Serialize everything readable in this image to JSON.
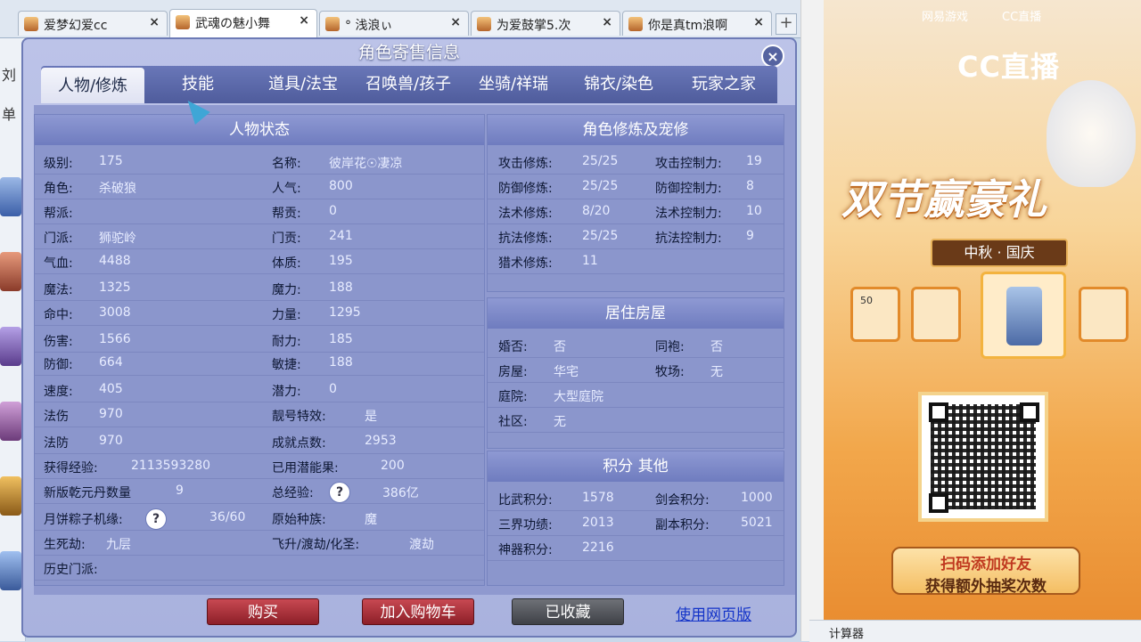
{
  "browser": {
    "tabs": [
      {
        "title": "爱梦幻爱cc",
        "close": "×"
      },
      {
        "title": "武魂の魅小舞",
        "close": "×"
      },
      {
        "title": "°  浅浪ぃ",
        "close": "×"
      },
      {
        "title": "为爱鼓掌5.次",
        "close": "×"
      },
      {
        "title": "你是真tm浪啊",
        "close": "×"
      }
    ],
    "new_tab": "+",
    "left_fragments": [
      "刘",
      "单"
    ]
  },
  "dialog": {
    "title": "角色寄售信息",
    "close": "×",
    "tabs": [
      "人物/修炼",
      "技能",
      "道具/法宝",
      "召唤兽/孩子",
      "坐骑/祥瑞",
      "锦衣/染色",
      "玩家之家"
    ],
    "active_tab": 0
  },
  "char_status": {
    "header": "人物状态",
    "left": [
      {
        "label": "级别:",
        "value": "175"
      },
      {
        "label": "角色:",
        "value": "杀破狼"
      },
      {
        "label": "帮派:",
        "value": ""
      },
      {
        "label": "门派:",
        "value": "狮驼岭"
      },
      {
        "label": "气血:",
        "value": "4488"
      },
      {
        "label": "魔法:",
        "value": "1325"
      },
      {
        "label": "命中:",
        "value": "3008"
      },
      {
        "label": "伤害:",
        "value": "1566"
      },
      {
        "label": "防御:",
        "value": "664"
      },
      {
        "label": "速度:",
        "value": "405"
      },
      {
        "label": "法伤",
        "value": "970"
      },
      {
        "label": "法防",
        "value": "970"
      },
      {
        "label": "获得经验:",
        "value": "2113593280"
      },
      {
        "label": "新版乾元丹数量",
        "value": "9"
      },
      {
        "label": "月饼粽子机缘:",
        "value": "36/60"
      },
      {
        "label": "生死劫:",
        "value": "九层"
      },
      {
        "label": "历史门派:",
        "value": ""
      }
    ],
    "right": [
      {
        "label": "名称:",
        "value": "彼岸花☉凄凉"
      },
      {
        "label": "人气:",
        "value": "800"
      },
      {
        "label": "帮贡:",
        "value": "0"
      },
      {
        "label": "门贡:",
        "value": "241"
      },
      {
        "label": "体质:",
        "value": "195"
      },
      {
        "label": "魔力:",
        "value": "188"
      },
      {
        "label": "力量:",
        "value": "1295"
      },
      {
        "label": "耐力:",
        "value": "185"
      },
      {
        "label": "敏捷:",
        "value": "188"
      },
      {
        "label": "潜力:",
        "value": "0"
      },
      {
        "label": "靓号特效:",
        "value": "是"
      },
      {
        "label": "成就点数:",
        "value": "2953"
      },
      {
        "label": "已用潜能果:",
        "value": "200"
      },
      {
        "label": "总经验:",
        "value": "386亿"
      },
      {
        "label": "原始种族:",
        "value": "魔"
      },
      {
        "label": "飞升/渡劫/化圣:",
        "value": "渡劫"
      }
    ],
    "help": "?"
  },
  "cultivation": {
    "header": "角色修炼及宠修",
    "left": [
      {
        "label": "攻击修炼:",
        "value": "25/25"
      },
      {
        "label": "防御修炼:",
        "value": "25/25"
      },
      {
        "label": "法术修炼:",
        "value": "8/20"
      },
      {
        "label": "抗法修炼:",
        "value": "25/25"
      },
      {
        "label": "猎术修炼:",
        "value": "11"
      }
    ],
    "right": [
      {
        "label": "攻击控制力:",
        "value": "19"
      },
      {
        "label": "防御控制力:",
        "value": "8"
      },
      {
        "label": "法术控制力:",
        "value": "10"
      },
      {
        "label": "抗法控制力:",
        "value": "9"
      }
    ]
  },
  "house": {
    "header": "居住房屋",
    "left": [
      {
        "label": "婚否:",
        "value": "否"
      },
      {
        "label": "房屋:",
        "value": "华宅"
      },
      {
        "label": "庭院:",
        "value": "大型庭院"
      },
      {
        "label": "社区:",
        "value": "无"
      }
    ],
    "right": [
      {
        "label": "同袍:",
        "value": "否"
      },
      {
        "label": "牧场:",
        "value": "无"
      }
    ]
  },
  "points": {
    "header": "积分 其他",
    "left": [
      {
        "label": "比武积分:",
        "value": "1578"
      },
      {
        "label": "三界功绩:",
        "value": "2013"
      },
      {
        "label": "神器积分:",
        "value": "2216"
      }
    ],
    "right": [
      {
        "label": "剑会积分:",
        "value": "1000"
      },
      {
        "label": "副本积分:",
        "value": "5021"
      }
    ]
  },
  "actions": {
    "buy": "购买",
    "add_cart": "加入购物车",
    "favorited": "已收藏",
    "web_version": "使用网页版"
  },
  "ad": {
    "netease": "网易游戏",
    "cc_small": "CC直播",
    "cc_logo": "CC直播",
    "slogan": "双节赢豪礼",
    "festival": "中秋 · 国庆",
    "item_badge": "50",
    "cta_line1": "扫码添加好友",
    "cta_line2": "获得额外抽奖次数"
  },
  "taskbar": {
    "label": "计算器"
  }
}
